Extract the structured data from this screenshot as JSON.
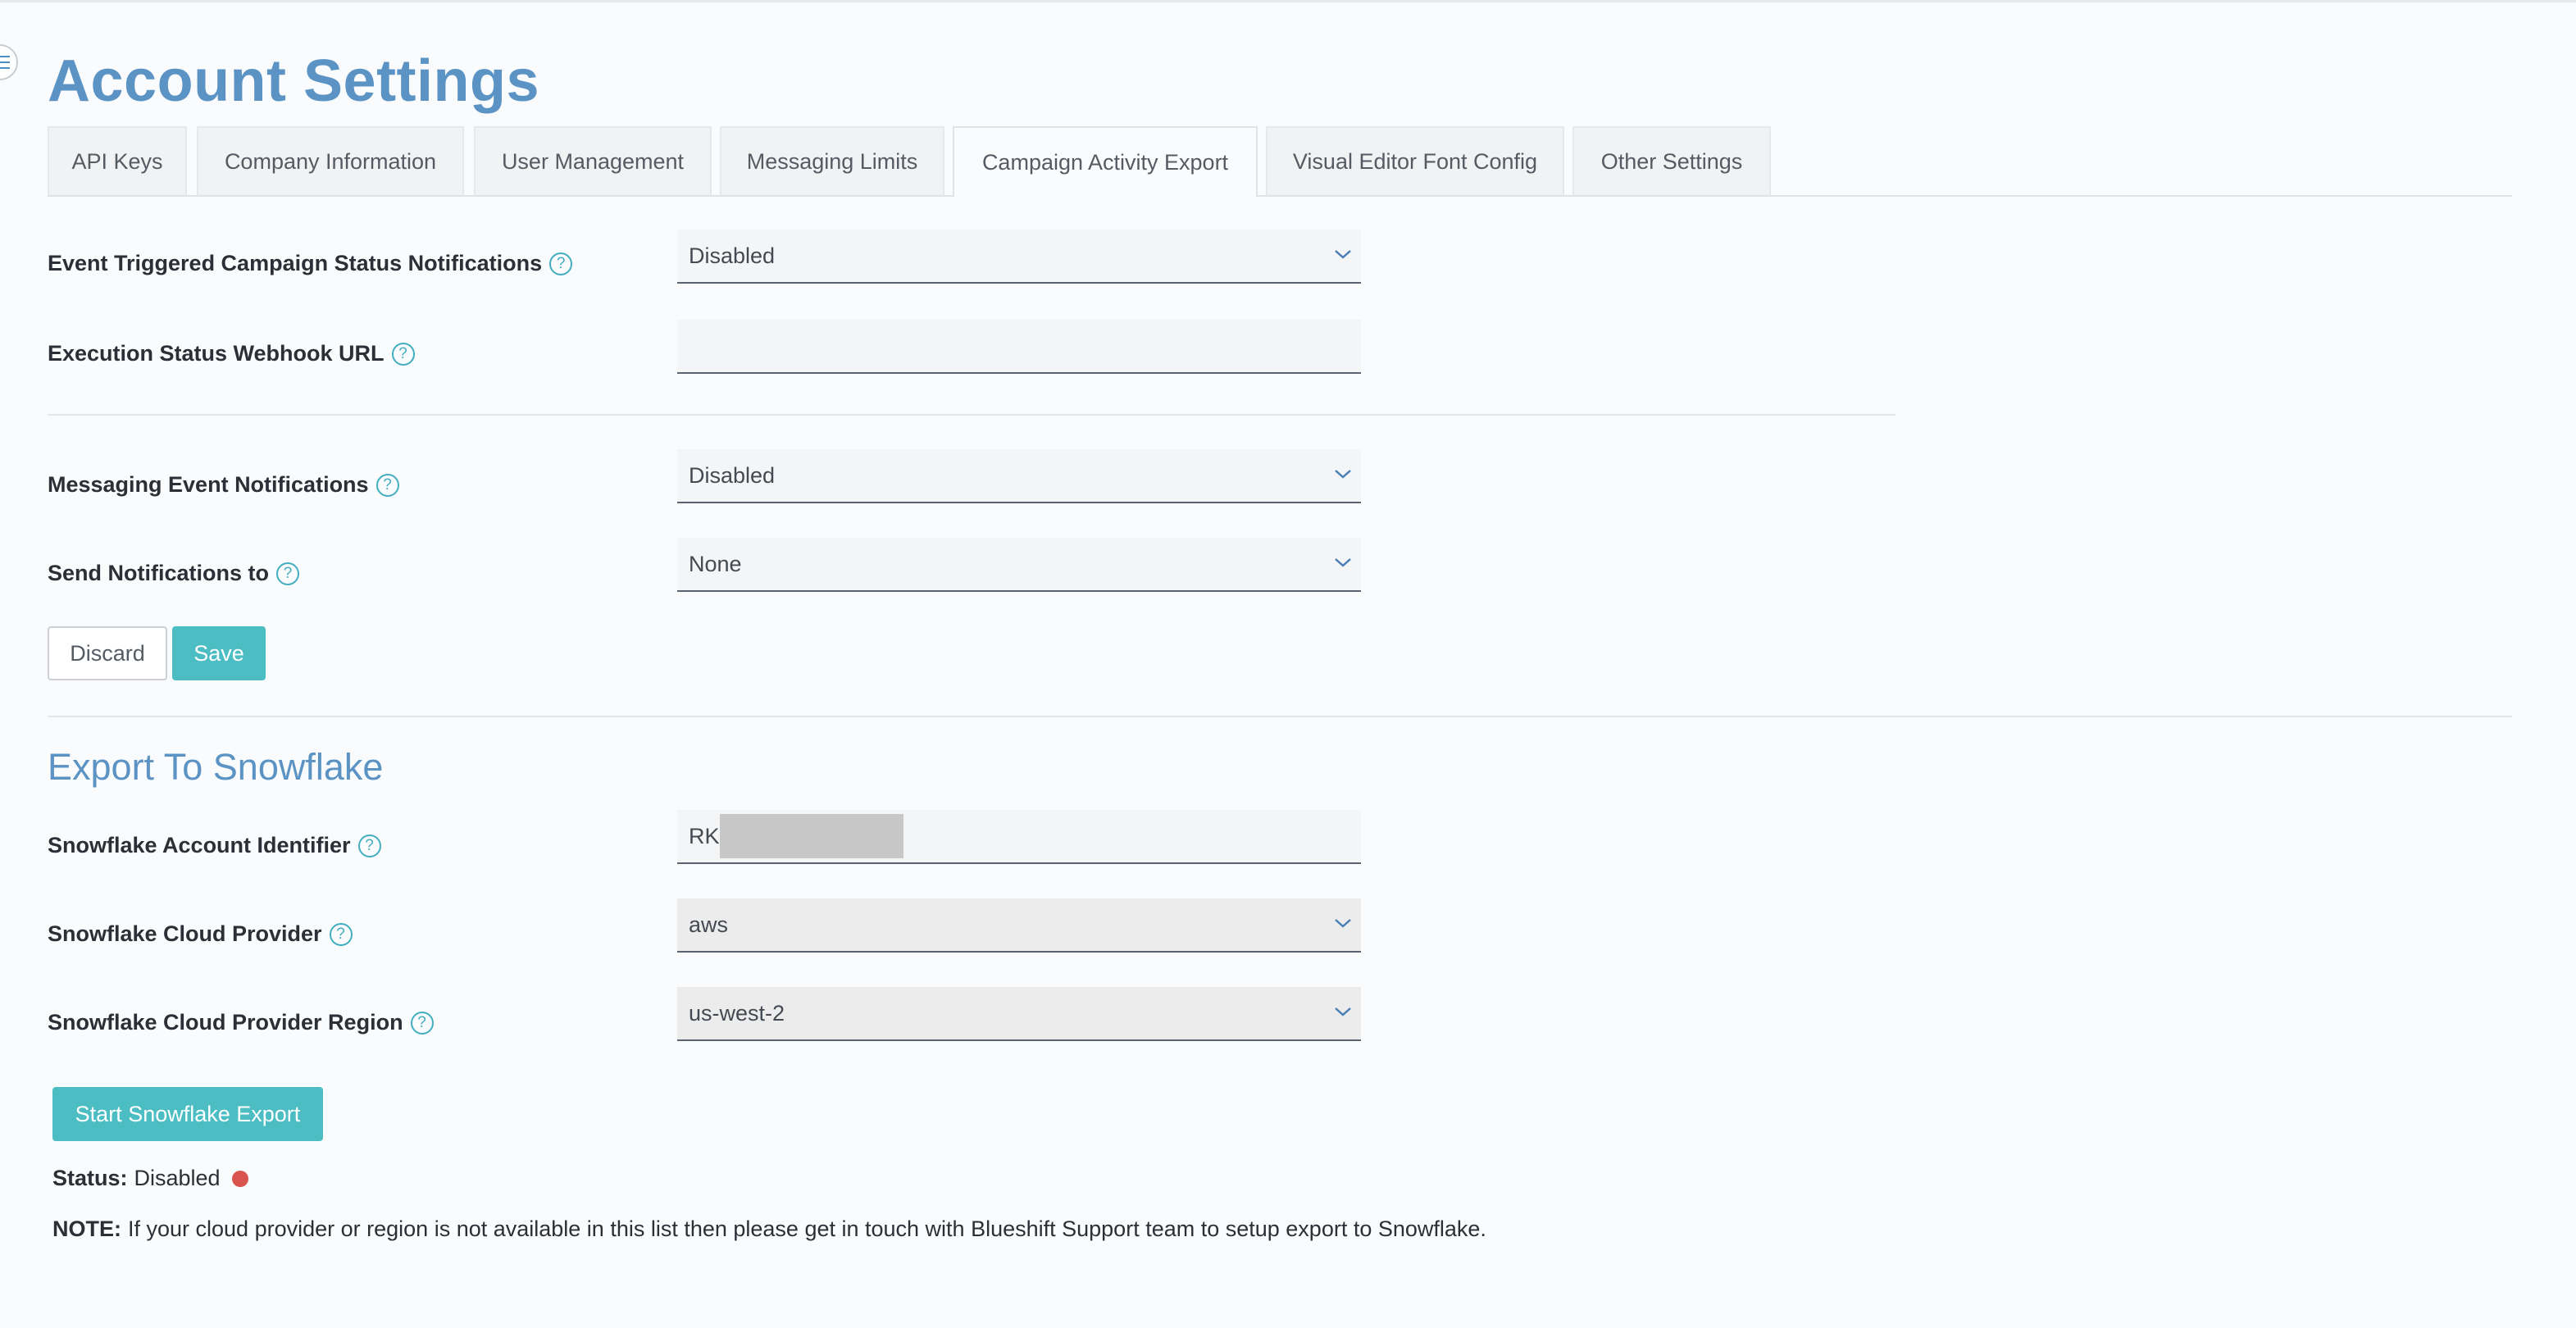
{
  "page": {
    "title": "Account Settings"
  },
  "tabs": [
    {
      "label": "API Keys"
    },
    {
      "label": "Company Information"
    },
    {
      "label": "User Management"
    },
    {
      "label": "Messaging Limits"
    },
    {
      "label": "Campaign Activity Export",
      "active": true
    },
    {
      "label": "Visual Editor Font Config"
    },
    {
      "label": "Other Settings"
    }
  ],
  "notifications": {
    "event_triggered": {
      "label": "Event Triggered Campaign Status Notifications",
      "value": "Disabled"
    },
    "webhook_url": {
      "label": "Execution Status Webhook URL",
      "value": ""
    },
    "messaging_event": {
      "label": "Messaging Event Notifications",
      "value": "Disabled"
    },
    "send_to": {
      "label": "Send Notifications to",
      "value": "None"
    }
  },
  "actions": {
    "discard_label": "Discard",
    "save_label": "Save"
  },
  "snowflake": {
    "section_title": "Export To Snowflake",
    "account_identifier": {
      "label": "Snowflake Account Identifier",
      "value": "RK"
    },
    "cloud_provider": {
      "label": "Snowflake Cloud Provider",
      "value": "aws"
    },
    "region": {
      "label": "Snowflake Cloud Provider Region",
      "value": "us-west-2"
    },
    "export_button_label": "Start Snowflake Export",
    "status_label": "Status:",
    "status_value": "Disabled",
    "note_label": "NOTE:",
    "note_text": "If your cloud provider or region is not available in this list then please get in touch with Blueshift Support team to setup export to Snowflake."
  },
  "icons": {
    "help": "help-circle-icon",
    "dropdown": "chevron-down-icon",
    "menu": "menu-icon"
  },
  "colors": {
    "accent": "#4cbdc3",
    "title": "#5b93c4",
    "status_disabled": "#d9534f"
  }
}
